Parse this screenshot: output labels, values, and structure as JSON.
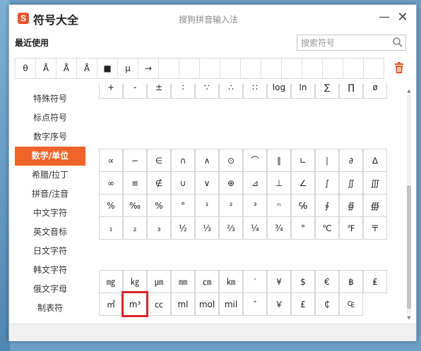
{
  "window": {
    "title": "符号大全",
    "subtitle": "搜狗拼音输入法",
    "logo_text": "S",
    "minimize_glyph": "—",
    "close_glyph": "✕"
  },
  "recent": {
    "label": "最近使用",
    "symbols": [
      "θ",
      "Å",
      "Å",
      "Å",
      "■",
      "μ",
      "→",
      "",
      "",
      "",
      "",
      "",
      "",
      "",
      "",
      "",
      "",
      ""
    ]
  },
  "search": {
    "placeholder": "搜索符号",
    "value": ""
  },
  "sidebar": {
    "items": [
      {
        "label": "特殊符号",
        "active": false
      },
      {
        "label": "标点符号",
        "active": false
      },
      {
        "label": "数字序号",
        "active": false
      },
      {
        "label": "数学/单位",
        "active": true
      },
      {
        "label": "希腊/拉丁",
        "active": false
      },
      {
        "label": "拼音/注音",
        "active": false
      },
      {
        "label": "中文字符",
        "active": false
      },
      {
        "label": "英文音标",
        "active": false
      },
      {
        "label": "日文字符",
        "active": false
      },
      {
        "label": "韩文字符",
        "active": false
      },
      {
        "label": "俄文字母",
        "active": false
      },
      {
        "label": "制表符",
        "active": false
      }
    ]
  },
  "grid_top": [
    "+",
    "-",
    "±",
    "∶",
    "∵",
    "∴",
    "∷",
    "log",
    "ln",
    "∑",
    "∏",
    "ø"
  ],
  "grid_math": [
    "∝",
    "∽",
    "∈",
    "∩",
    "∧",
    "⊙",
    "⌒",
    "∥",
    "∟",
    "∣",
    "∂",
    "∆",
    "∞",
    "≌",
    "∉",
    "∪",
    "∨",
    "⊕",
    "⊿",
    "⊥",
    "∠",
    "∫",
    "∬",
    "∭",
    "%",
    "‰",
    "%",
    "°",
    "¹",
    "²",
    "³",
    "ⁿ",
    "℅",
    "∮",
    "∯",
    "∰",
    "₁",
    "₂",
    "₃",
    "½",
    "⅓",
    "⅔",
    "¼",
    "¾",
    "°",
    "℃",
    "℉",
    "〒"
  ],
  "grid_units": [
    "㎎",
    "㎏",
    "㎛",
    "㎜",
    "㎝",
    "㎞",
    "′",
    "¥",
    "$",
    "€",
    "฿",
    "₤",
    "㎡",
    "m³",
    "㏄",
    "ml",
    "mol",
    "mil",
    "″",
    "￥",
    "£",
    "₵",
    "₠"
  ],
  "highlighted_symbol": "m³"
}
